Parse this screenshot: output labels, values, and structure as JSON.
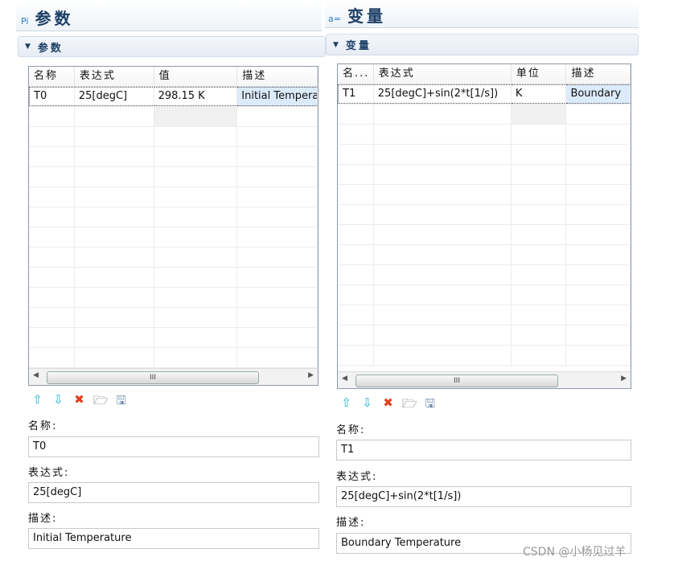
{
  "left": {
    "title_icon": "Pi",
    "title": "参数",
    "section": "参数",
    "columns": [
      "名称",
      "表达式",
      "值",
      "描述"
    ],
    "row": [
      "T0",
      "25[degC]",
      "298.15 K",
      "Initial Tempera"
    ],
    "fields": [
      {
        "label": "名称:",
        "value": "T0"
      },
      {
        "label": "表达式:",
        "value": "25[degC]"
      },
      {
        "label": "描述:",
        "value": "Initial Temperature"
      }
    ]
  },
  "right": {
    "title_icon": "a=",
    "title": "变量",
    "section": "变量",
    "columns": [
      "名...",
      "表达式",
      "单位",
      "描述"
    ],
    "row": [
      "T1",
      "25[degC]+sin(2*t[1/s])",
      "K",
      "Boundary"
    ],
    "fields": [
      {
        "label": "名称:",
        "value": "T1"
      },
      {
        "label": "表达式:",
        "value": "25[degC]+sin(2*t[1/s])"
      },
      {
        "label": "描述:",
        "value": "Boundary Temperature"
      }
    ]
  },
  "icons": [
    "move-up-icon",
    "move-down-icon",
    "delete-icon",
    "open-folder-icon",
    "save-icon"
  ],
  "scroll_thumb": "III",
  "watermark": "CSDN @小杨见过羊"
}
